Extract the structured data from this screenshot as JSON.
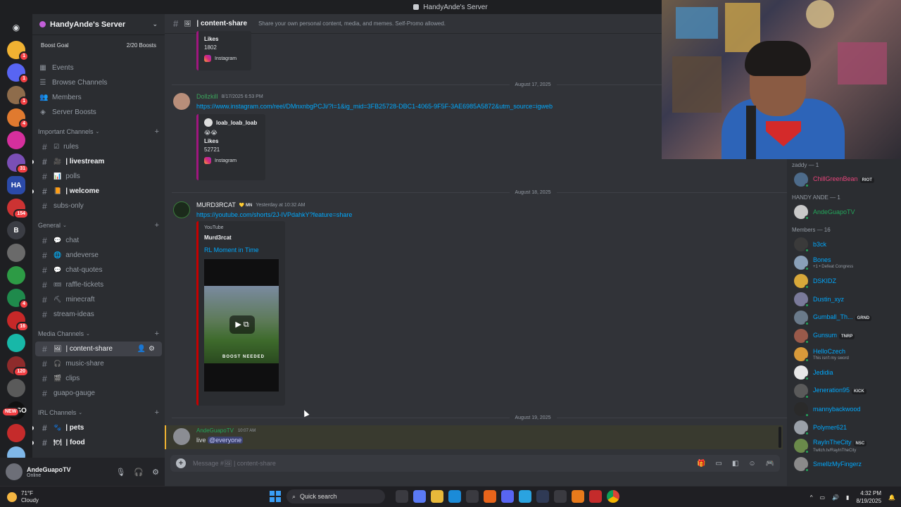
{
  "window": {
    "title": "HandyAnde's Server"
  },
  "guilds": [
    {
      "color": "#f0b232",
      "badge": "1"
    },
    {
      "color": "#5865f2",
      "badge": "1"
    },
    {
      "color": "#8e6c4b",
      "badge": "1"
    },
    {
      "color": "#e07a2f",
      "badge": "4"
    },
    {
      "color": "#d52f9d",
      "badge": ""
    },
    {
      "color": "#7a4fb5",
      "badge": "31"
    },
    {
      "color": "#2b4aa8",
      "badge": ""
    },
    {
      "color": "#c33",
      "badge": "154"
    },
    {
      "color": "#3b3d44",
      "badge": ""
    },
    {
      "color": "#6a6a6a",
      "badge": ""
    },
    {
      "color": "#2d9b45",
      "badge": ""
    },
    {
      "color": "#1f8a4c",
      "badge": "4"
    },
    {
      "color": "#c62828",
      "badge": "16"
    },
    {
      "color": "#18b8a8",
      "badge": ""
    },
    {
      "color": "#8e2b2b",
      "badge": "120"
    },
    {
      "color": "#5a5a5a",
      "badge": ""
    },
    {
      "color": "#111",
      "badge": ""
    },
    {
      "color": "#c52b2b",
      "badge": ""
    },
    {
      "color": "#7fb7e8",
      "badge": ""
    }
  ],
  "guild_labels": {
    "ha": "HA",
    "b": "B",
    "new": "NEW",
    "ohso": "OHSO"
  },
  "sidebar": {
    "server_name": "HandyAnde's Server",
    "boost_goal": "Boost Goal",
    "boost_count": "2/20 Boosts",
    "nav": [
      {
        "label": "Events",
        "icon": "calendar-icon"
      },
      {
        "label": "Browse Channels",
        "icon": "list-icon"
      },
      {
        "label": "Members",
        "icon": "members-icon"
      },
      {
        "label": "Server Boosts",
        "icon": "boost-icon"
      }
    ],
    "categories": [
      {
        "name": "Important Channels",
        "channels": [
          {
            "name": "rules",
            "emoji": "☑",
            "unread": false
          },
          {
            "name": "| livestream",
            "emoji": "🎥",
            "unread": true
          },
          {
            "name": "polls",
            "emoji": "📊",
            "unread": false
          },
          {
            "name": "| welcome",
            "emoji": "📙",
            "unread": true
          },
          {
            "name": "subs-only",
            "emoji": "",
            "unread": false
          }
        ]
      },
      {
        "name": "General",
        "channels": [
          {
            "name": "chat",
            "emoji": "💬",
            "unread": false
          },
          {
            "name": "andeverse",
            "emoji": "🌐",
            "unread": false
          },
          {
            "name": "chat-quotes",
            "emoji": "💬",
            "unread": false
          },
          {
            "name": "raffle-tickets",
            "emoji": "🎟",
            "unread": false
          },
          {
            "name": "minecraft",
            "emoji": "⛏",
            "unread": false
          },
          {
            "name": "stream-ideas",
            "emoji": "",
            "unread": false
          }
        ]
      },
      {
        "name": "Media Channels",
        "channels": [
          {
            "name": "| content-share",
            "emoji": "🖼",
            "unread": false,
            "active": true
          },
          {
            "name": "music-share",
            "emoji": "🎧",
            "unread": false
          },
          {
            "name": "clips",
            "emoji": "🎬",
            "unread": false
          },
          {
            "name": "guapo-gauge",
            "emoji": "",
            "unread": false
          }
        ]
      },
      {
        "name": "IRL Channels",
        "channels": [
          {
            "name": "| pets",
            "emoji": "🐾",
            "unread": true
          },
          {
            "name": "| food",
            "emoji": "🍽",
            "unread": true
          }
        ]
      }
    ]
  },
  "user": {
    "name": "AndeGuapoTV",
    "status": "Online"
  },
  "channel": {
    "name": "| content-share",
    "topic": "Share your own personal content, media, and memes. Self-Promo allowed."
  },
  "messages": {
    "top_embed": {
      "likes_label": "Likes",
      "likes": "1802",
      "footer": "Instagram"
    },
    "date1": "August 17, 2025",
    "m1": {
      "author": "Dollzkill",
      "time": "8/17/2025 6:53 PM",
      "link": "https://www.instagram.com/reel/DMnxnbgPCJi/?l=1&ig_mid=3FB25728-DBC1-4065-9F5F-3AE6985A5872&utm_source=igweb",
      "embed_author": "loab_loab_loab",
      "embed_emoji": "😭😭",
      "likes_label": "Likes",
      "likes": "52721",
      "footer": "Instagram"
    },
    "date2": "August 18, 2025",
    "m2": {
      "author": "MURD3RCAT",
      "tag": "MN",
      "time": "Yesterday at 10:32 AM",
      "link": "https://youtube.com/shorts/2J-IVPdahkY?feature=share",
      "provider": "YouTube",
      "embed_author": "Murd3rcat",
      "embed_title": "RL Moment in Time",
      "thumb_caption": "BOOST NEEDED"
    },
    "date3": "August 19, 2025",
    "m3": {
      "author": "AndeGuapoTV",
      "time": "10:07 AM",
      "text": "live",
      "mention": "@everyone"
    }
  },
  "composer": {
    "placeholder": "Message #🖼 | content-share"
  },
  "members": {
    "groups": [
      {
        "name": "zaddy — 1",
        "items": [
          {
            "name": "ChillGreenBean",
            "color": "#e8457b",
            "tag": "RIOT",
            "sub": ""
          }
        ]
      },
      {
        "name": "HANDY ANDE — 1",
        "items": [
          {
            "name": "AndeGuapoTV",
            "color": "#23a55a",
            "tag": "",
            "sub": ""
          }
        ]
      },
      {
        "name": "Members — 16",
        "items": [
          {
            "name": "b3ck",
            "color": "#00a8fc",
            "tag": "",
            "sub": ""
          },
          {
            "name": "Bones",
            "color": "#00a8fc",
            "tag": "",
            "sub": "+1 • Defeat Congress"
          },
          {
            "name": "DSKIDZ",
            "color": "#00a8fc",
            "tag": "",
            "sub": ""
          },
          {
            "name": "Dustin_xyz",
            "color": "#00a8fc",
            "tag": "",
            "sub": ""
          },
          {
            "name": "Gumball_Th...",
            "color": "#00a8fc",
            "tag": "GRND",
            "sub": ""
          },
          {
            "name": "Gunsum",
            "color": "#00a8fc",
            "tag": "TNRP",
            "sub": ""
          },
          {
            "name": "HelloCzech",
            "color": "#00a8fc",
            "tag": "",
            "sub": "This isn't my sword"
          },
          {
            "name": "Jedidia",
            "color": "#00a8fc",
            "tag": "",
            "sub": ""
          },
          {
            "name": "Jeneration95",
            "color": "#00a8fc",
            "tag": "KICK",
            "sub": ""
          },
          {
            "name": "mannybackwood",
            "color": "#00a8fc",
            "tag": "",
            "sub": ""
          },
          {
            "name": "Polymer621",
            "color": "#00a8fc",
            "tag": "",
            "sub": ""
          },
          {
            "name": "RayInTheCity",
            "color": "#00a8fc",
            "tag": "NSC",
            "sub": "Twitch.tv/RayInTheCity"
          },
          {
            "name": "SmellzMyFingerz",
            "color": "#00a8fc",
            "tag": "",
            "sub": ""
          }
        ]
      }
    ]
  },
  "taskbar": {
    "temp": "71°F",
    "weather": "Cloudy",
    "search": "Quick search",
    "time": "4:32 PM",
    "date": "8/19/2025",
    "apps": [
      "task-view",
      "copilot",
      "files",
      "edge",
      "store",
      "firefox",
      "discord",
      "telegram",
      "app-1",
      "app-2",
      "app-3",
      "app-4",
      "chrome"
    ]
  }
}
